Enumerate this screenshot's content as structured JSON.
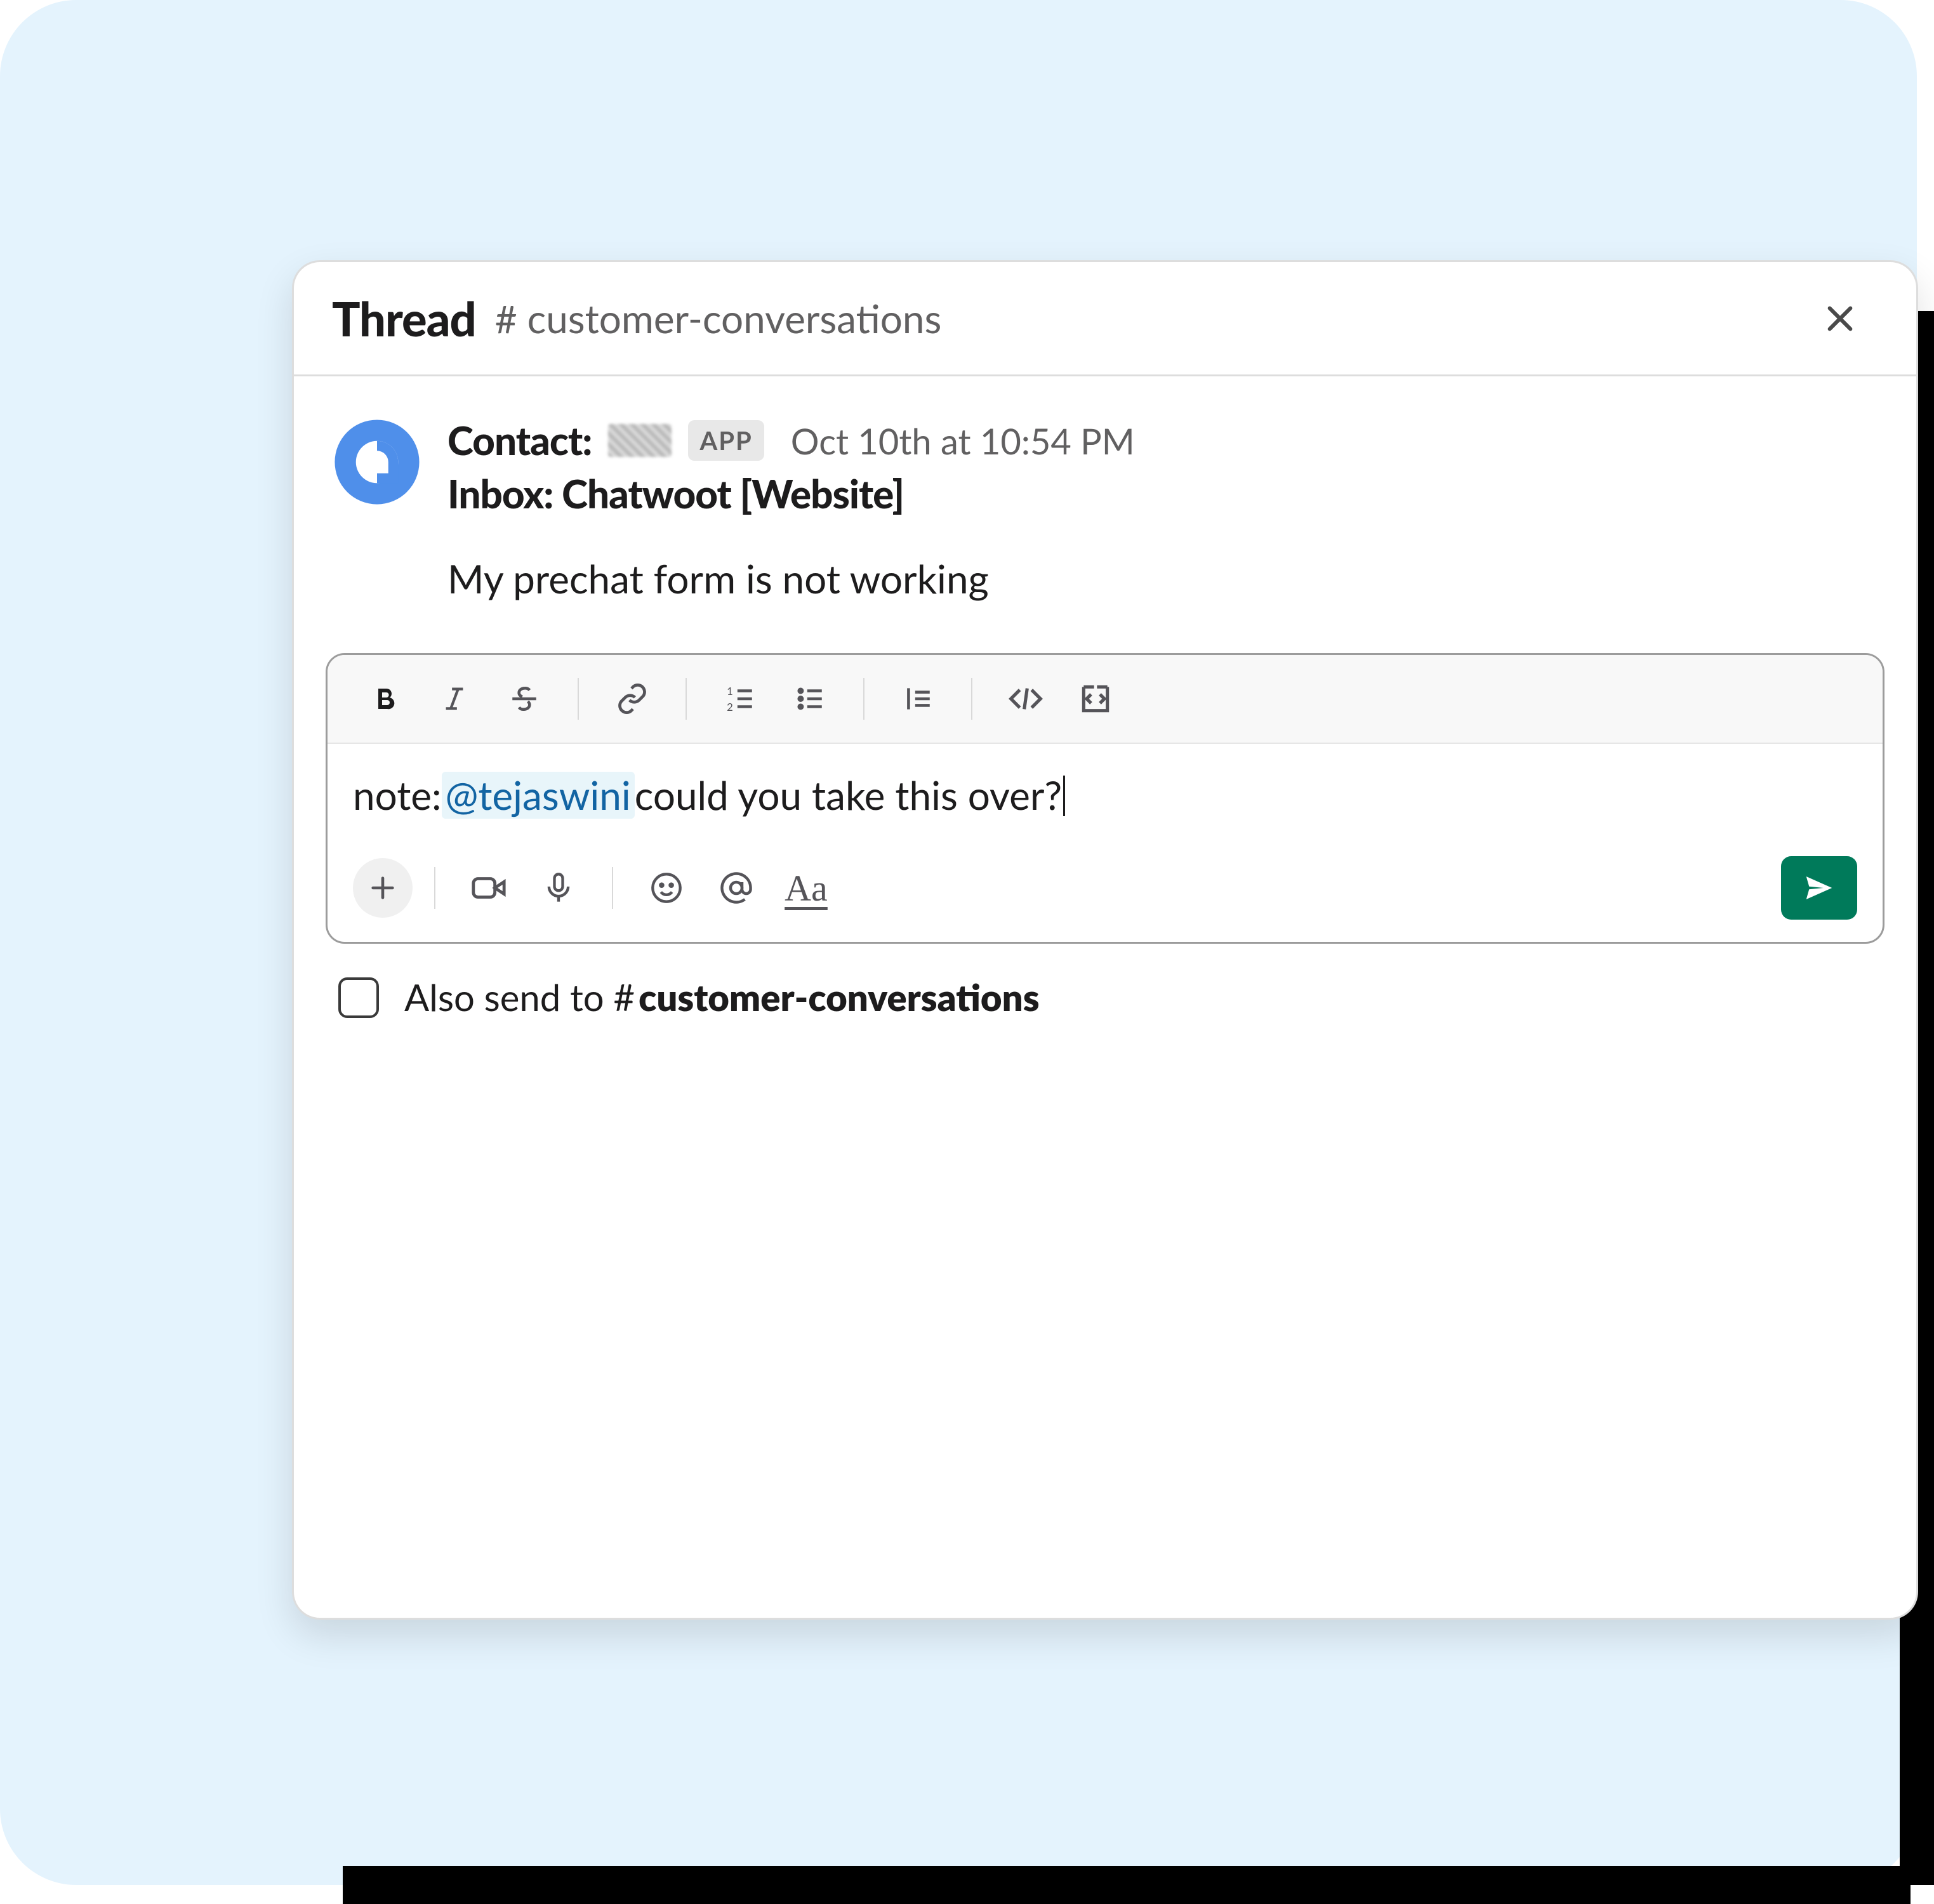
{
  "header": {
    "title": "Thread",
    "hash": "#",
    "channel": "customer-conversations"
  },
  "message": {
    "contact_label": "Contact:",
    "app_badge": "APP",
    "timestamp": "Oct 10th at 10:54 PM",
    "inbox_line": "Inbox: Chatwoot [Website]",
    "body": "My prechat form is not working"
  },
  "composer": {
    "prefix": "note: ",
    "mention": "@tejaswini",
    "suffix": "  could you take this over?"
  },
  "also_send": {
    "prefix": "Also send to ",
    "hash": "#",
    "channel": "customer-conversations"
  },
  "aa": "Aa"
}
